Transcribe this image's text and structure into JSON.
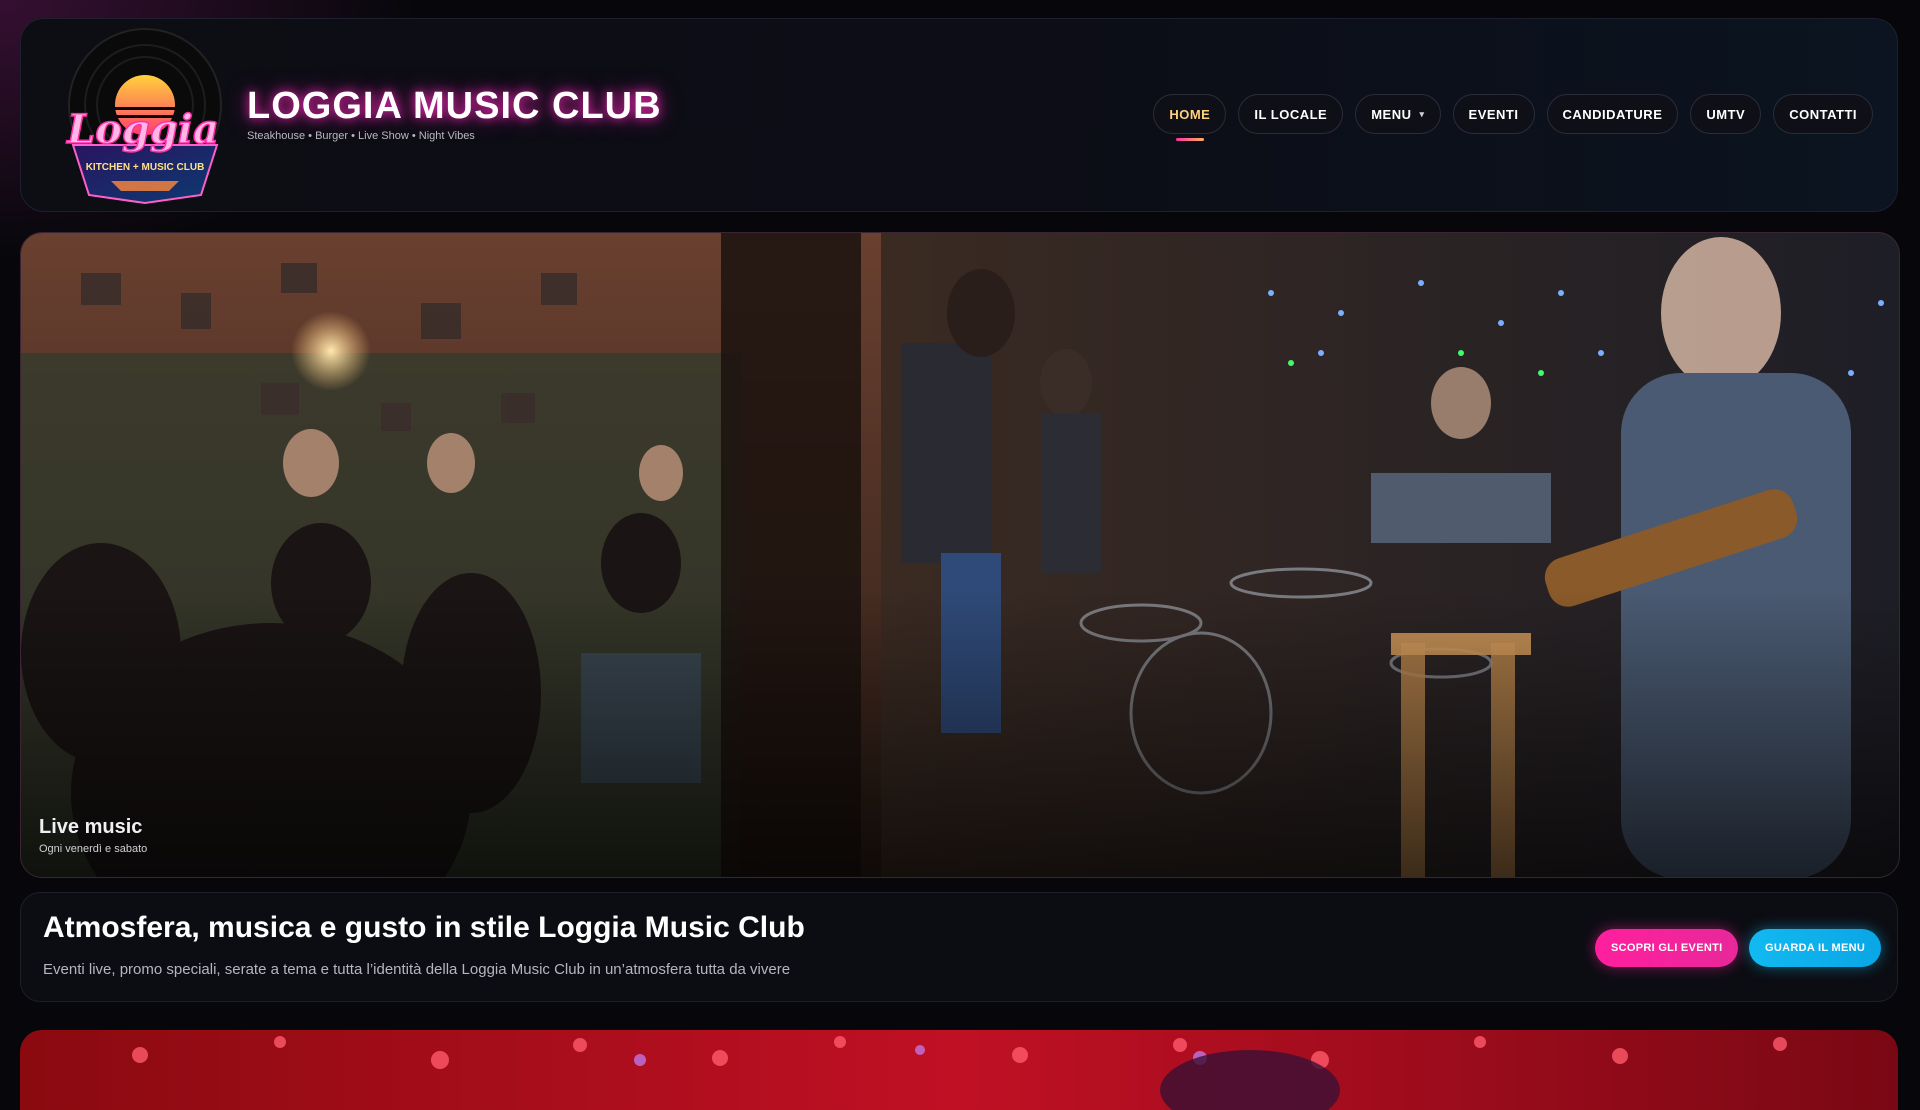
{
  "header": {
    "title": "LOGGIA MUSIC CLUB",
    "tagline": "Steakhouse • Burger • Live Show • Night Vibes",
    "logo": {
      "script_text": "Loggia",
      "sub_text": "KITCHEN + MUSIC CLUB"
    }
  },
  "nav": {
    "items": [
      {
        "label": "HOME",
        "active": true
      },
      {
        "label": "IL LOCALE"
      },
      {
        "label": "MENU",
        "caret": "▾"
      },
      {
        "label": "EVENTI"
      },
      {
        "label": "CANDIDATURE"
      },
      {
        "label": "UMTV"
      },
      {
        "label": "CONTATTI"
      }
    ]
  },
  "hero": {
    "title": "Live music",
    "subtitle": "Ogni venerdì e sabato"
  },
  "intro": {
    "title": "Atmosfera, musica e gusto in stile Loggia Music Club",
    "description": "Eventi live, promo speciali, serate a tema e tutta l’identità della Loggia Music Club in un’atmosfera tutta da vivere",
    "buttons": {
      "events": "SCOPRI GLI EVENTI",
      "menu": "GUARDA IL MENU"
    }
  },
  "colors": {
    "accent_pink": "#ff1f9e",
    "accent_cyan": "#12b9f0",
    "active_nav": "#ffd27a",
    "background": "#07070b"
  }
}
